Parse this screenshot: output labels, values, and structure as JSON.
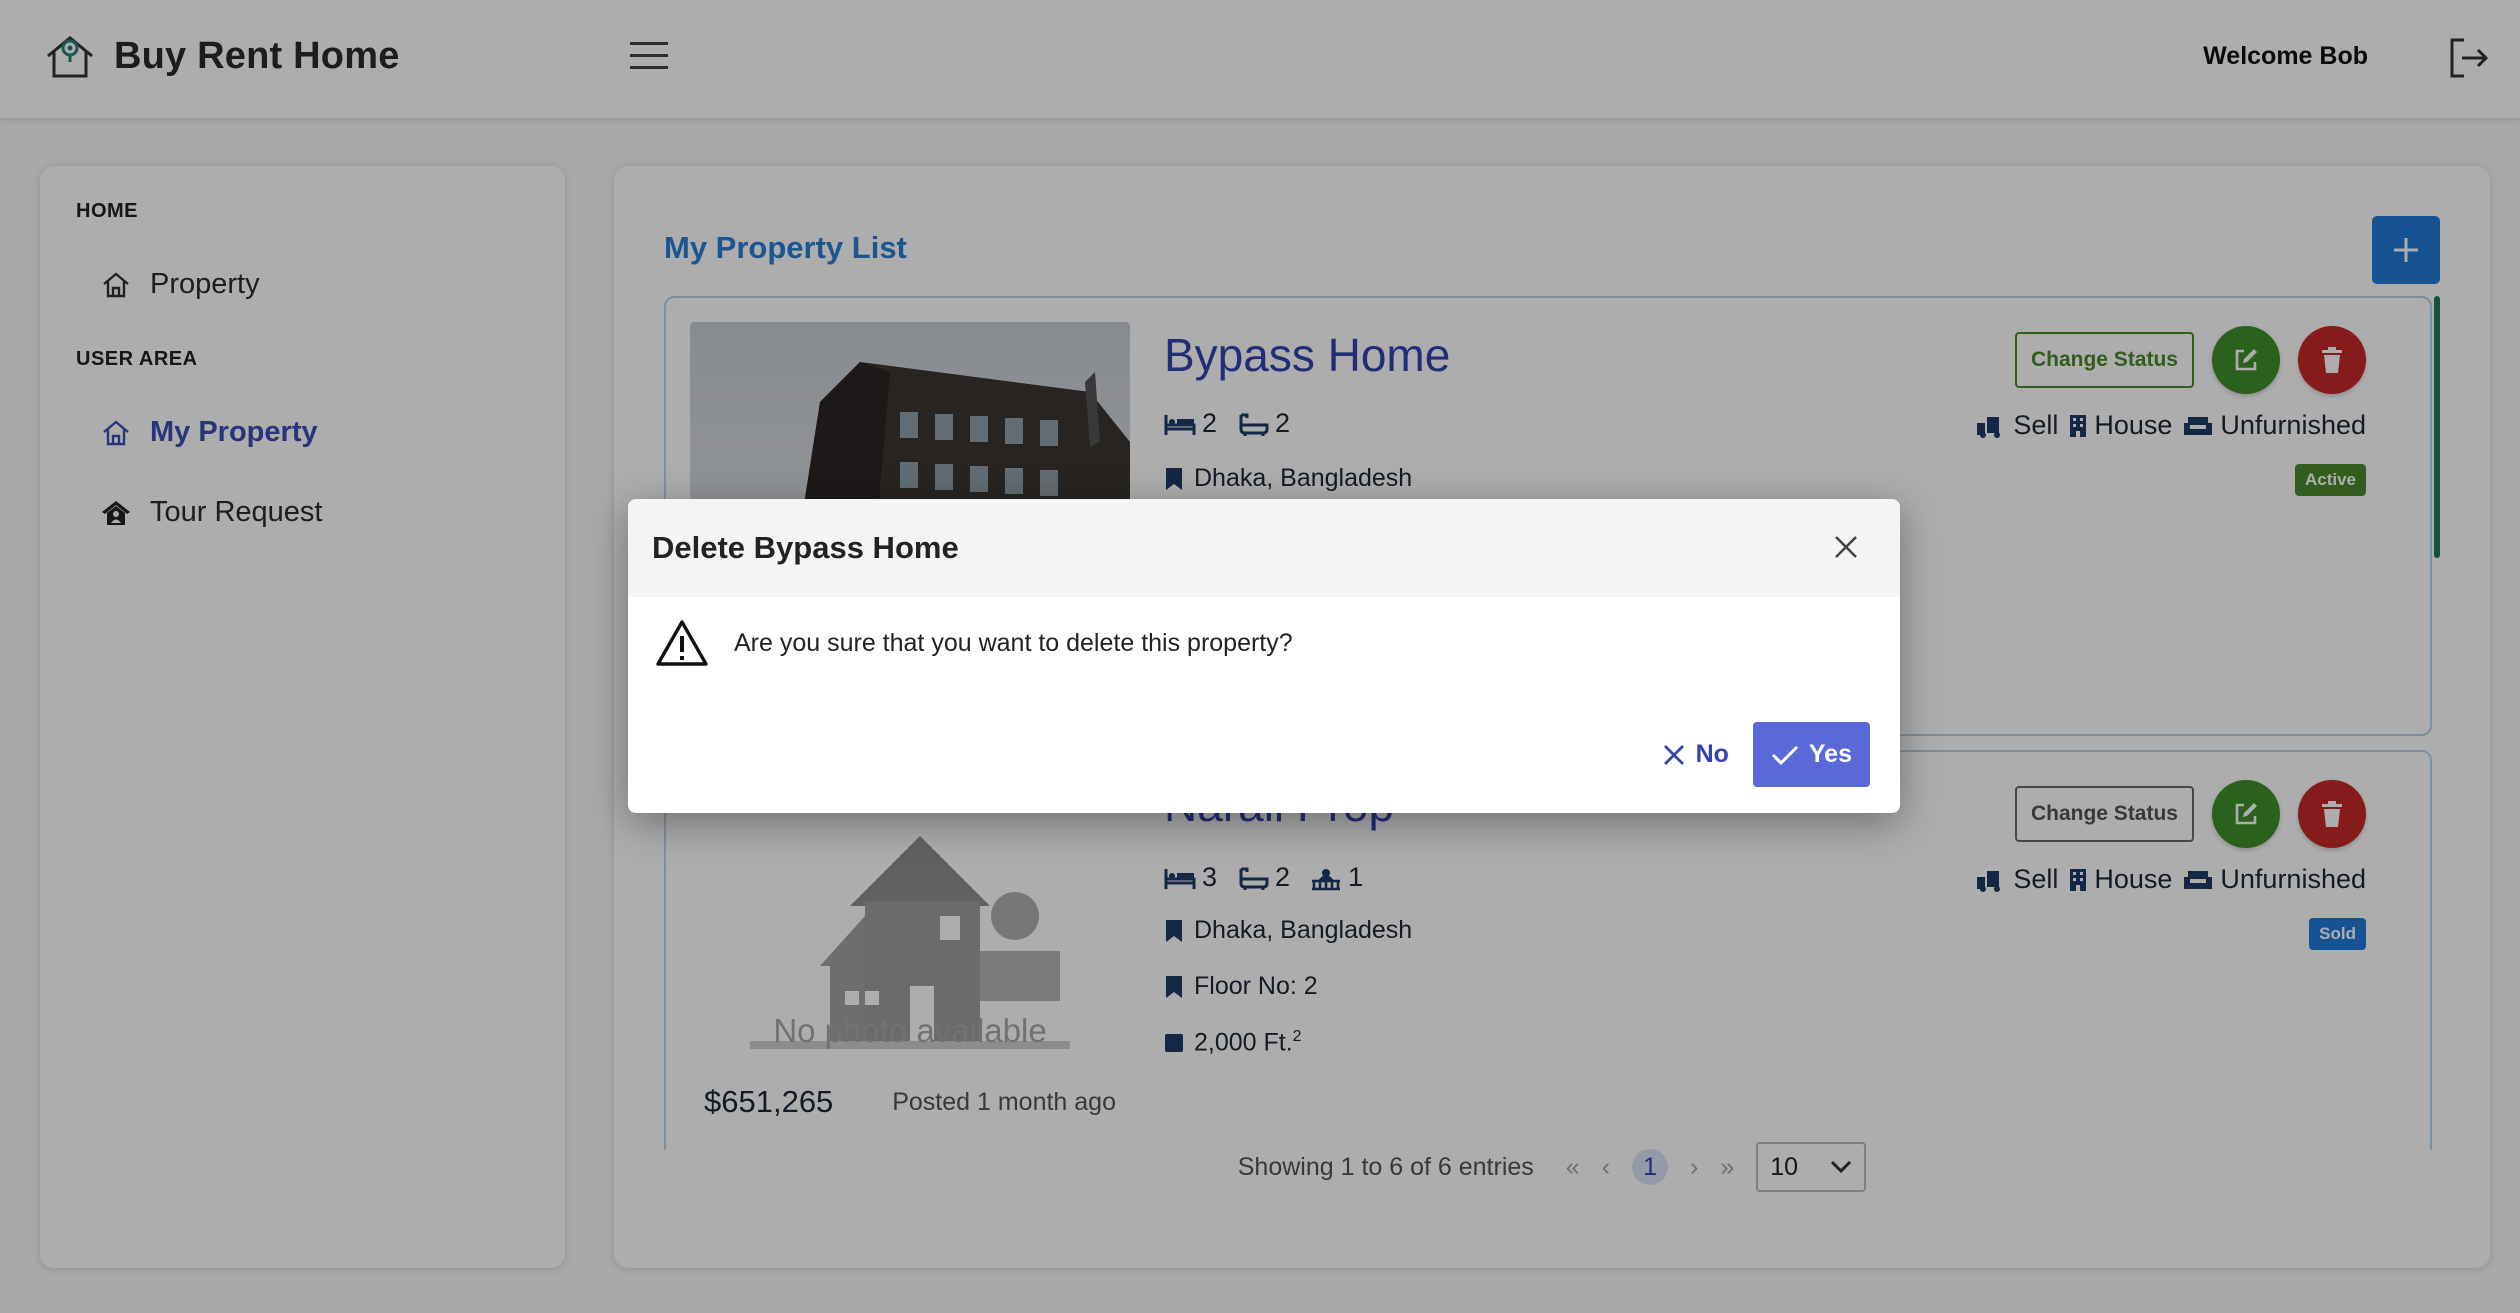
{
  "header": {
    "brand_name": "Buy Rent Home",
    "welcome_text": "Welcome Bob"
  },
  "sidebar": {
    "section_home": "HOME",
    "item_property": "Property",
    "section_user": "USER AREA",
    "item_my_property": "My Property",
    "item_tour_request": "Tour Request"
  },
  "main": {
    "title": "My Property List",
    "properties": [
      {
        "name": "Bypass Home",
        "beds": "2",
        "baths": "2",
        "location": "Dhaka, Bangladesh",
        "change_status_label": "Change Status",
        "purpose": "Sell",
        "type": "House",
        "furnishing": "Unfurnished",
        "status": "Active",
        "status_color": "#4a8a2a"
      },
      {
        "name": "Narail Prop",
        "beds": "3",
        "baths": "2",
        "balconies": "1",
        "location": "Dhaka, Bangladesh",
        "floor": "Floor No: 2",
        "area": "2,000 Ft.",
        "area_sup": "2",
        "change_status_label": "Change Status",
        "purpose": "Sell",
        "type": "House",
        "furnishing": "Unfurnished",
        "status": "Sold",
        "status_color": "#1f7bd8",
        "photo_placeholder": "No photo available",
        "price": "$651,265",
        "posted": "Posted 1 month ago"
      }
    ],
    "pagination": {
      "summary": "Showing 1 to 6 of 6 entries",
      "current_page": "1",
      "rows_per_page": "10"
    }
  },
  "dialog": {
    "title": "Delete Bypass Home",
    "message": "Are you sure that you want to delete this property?",
    "no_label": "No",
    "yes_label": "Yes"
  },
  "colors": {
    "accent": "#3443b0",
    "primary_button": "#1f7bd8",
    "yes_button": "#5969d8",
    "danger": "#c62828",
    "success": "#3f8f2a"
  }
}
